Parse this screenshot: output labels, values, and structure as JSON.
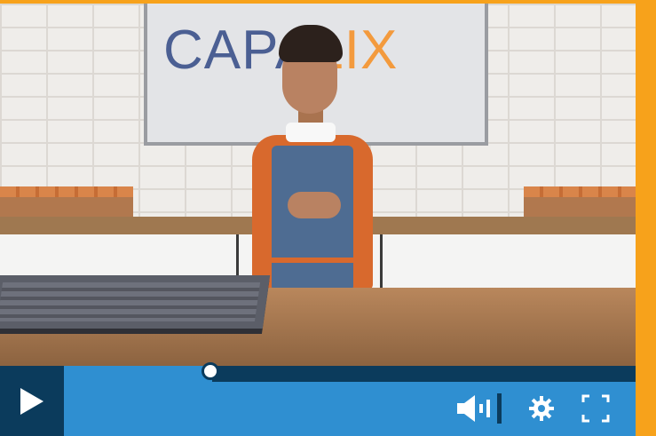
{
  "video": {
    "sign": {
      "brand_part1": "CAPA",
      "brand_part2": "LIX",
      "tagline": ""
    },
    "brand_colors": {
      "primary": "#4b5f93",
      "accent": "#f39a3d"
    }
  },
  "player": {
    "progress_fraction": 0.26,
    "colors": {
      "bar": "#2f8fd1",
      "dark": "#0b3b5c",
      "frame": "#f7a21b"
    },
    "icons": {
      "play": "play-icon",
      "volume": "volume-icon",
      "settings": "gear-icon",
      "fullscreen": "fullscreen-icon"
    }
  }
}
